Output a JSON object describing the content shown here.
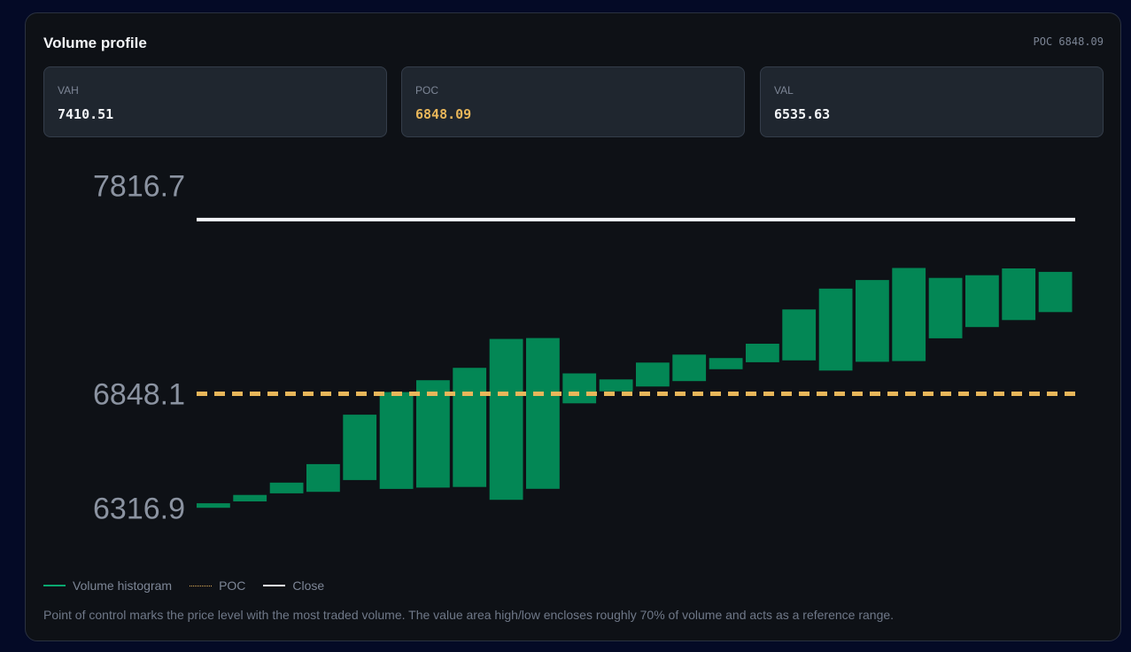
{
  "card": {
    "title": "Volume profile",
    "badge": "POC 6848.09"
  },
  "stats": [
    {
      "label": "VAH",
      "value": "7410.51",
      "color": "#f2f4f7"
    },
    {
      "label": "POC",
      "value": "6848.09",
      "color": "#e8b65a"
    },
    {
      "label": "VAL",
      "value": "6535.63",
      "color": "#f2f4f7"
    }
  ],
  "legend": [
    {
      "label": "Volume histogram",
      "color": "#0aa870",
      "style": "solid"
    },
    {
      "label": "POC",
      "color": "#e8b65a",
      "style": "dotted"
    },
    {
      "label": "Close",
      "color": "#f2f4f7",
      "style": "solid"
    }
  ],
  "footnote": "Point of control marks the price level with the most traded volume. The value area high/low encloses roughly 70% of volume and acts as a reference range.",
  "chart_data": {
    "type": "bar",
    "style": "floating-range",
    "y_ticks": [
      {
        "value": 7816.7,
        "label": "7816.7"
      },
      {
        "value": 6848.1,
        "label": "6848.1"
      },
      {
        "value": 6316.9,
        "label": "6316.9"
      }
    ],
    "ylim": [
      6216,
      7958
    ],
    "bar_color": "#038755",
    "poc": {
      "value": 6848.1,
      "color": "#e8b65a",
      "style": "dashed"
    },
    "close": {
      "value": 7658,
      "color": "#f2f4f7"
    },
    "bars": [
      {
        "low": 6318,
        "high": 6339
      },
      {
        "low": 6348,
        "high": 6378
      },
      {
        "low": 6385,
        "high": 6435
      },
      {
        "low": 6392,
        "high": 6521
      },
      {
        "low": 6447,
        "high": 6751
      },
      {
        "low": 6406,
        "high": 6856
      },
      {
        "low": 6412,
        "high": 6911
      },
      {
        "low": 6415,
        "high": 6969
      },
      {
        "low": 6355,
        "high": 7103
      },
      {
        "low": 6406,
        "high": 7107
      },
      {
        "low": 6804,
        "high": 6943
      },
      {
        "low": 6860,
        "high": 6915
      },
      {
        "low": 6882,
        "high": 6993
      },
      {
        "low": 6907,
        "high": 7030
      },
      {
        "low": 6962,
        "high": 7014
      },
      {
        "low": 6995,
        "high": 7081
      },
      {
        "low": 7003,
        "high": 7240
      },
      {
        "low": 6956,
        "high": 7337
      },
      {
        "low": 6997,
        "high": 7377
      },
      {
        "low": 7000,
        "high": 7433
      },
      {
        "low": 7106,
        "high": 7387
      },
      {
        "low": 7158,
        "high": 7399
      },
      {
        "low": 7191,
        "high": 7431
      },
      {
        "low": 7228,
        "high": 7415
      }
    ]
  }
}
